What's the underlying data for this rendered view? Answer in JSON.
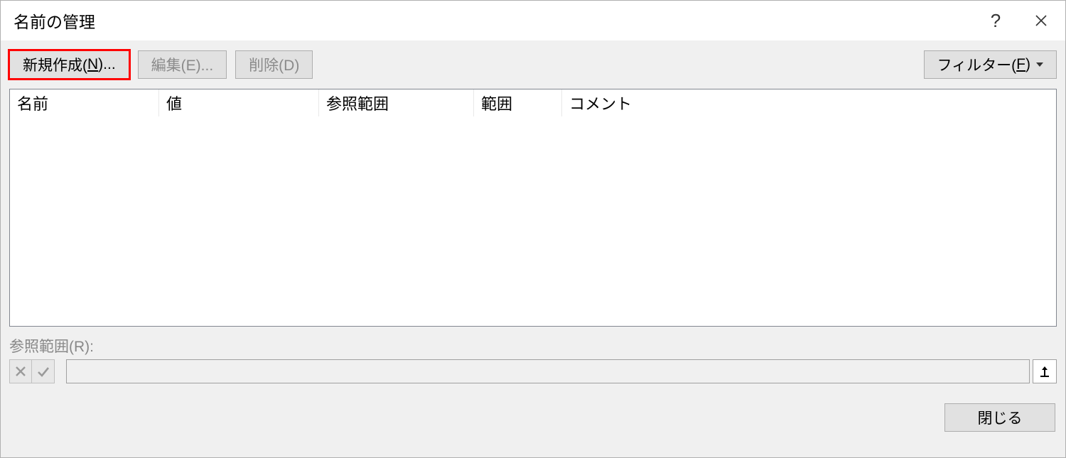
{
  "dialog": {
    "title": "名前の管理"
  },
  "toolbar": {
    "new_label_pre": "新規作成(",
    "new_accel": "N",
    "new_label_post": ")...",
    "edit_label": "編集(E)...",
    "delete_label": "削除(D)",
    "filter_label_pre": "フィルター(",
    "filter_accel": "F",
    "filter_label_post": ")"
  },
  "columns": {
    "name": "名前",
    "value": "値",
    "refersto": "参照範囲",
    "scope": "範囲",
    "comment": "コメント"
  },
  "refersto": {
    "label": "参照範囲(R):"
  },
  "footer": {
    "close_label": "閉じる"
  }
}
